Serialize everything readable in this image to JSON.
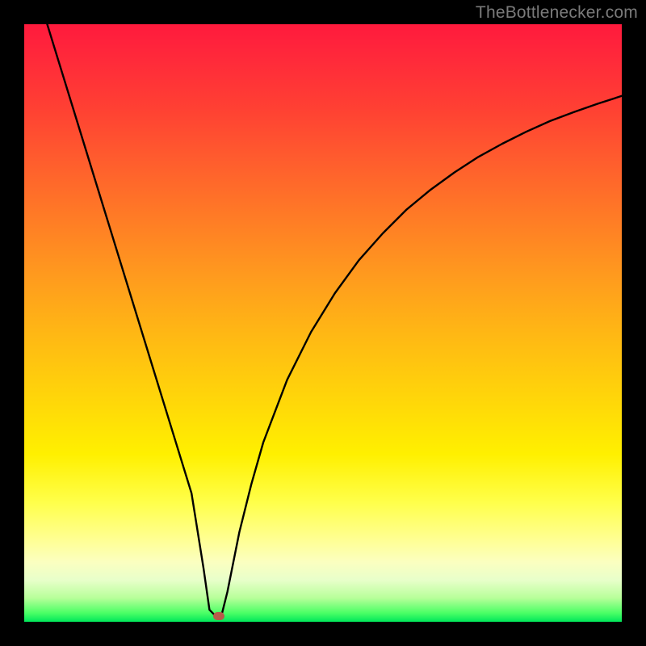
{
  "watermark": {
    "text": "TheBottlenecker.com"
  },
  "chart_data": {
    "type": "line",
    "title": "",
    "xlabel": "",
    "ylabel": "",
    "xlim": [
      0,
      100
    ],
    "ylim": [
      0,
      100
    ],
    "x": [
      0,
      2,
      4,
      6,
      8,
      10,
      12,
      14,
      16,
      18,
      20,
      22,
      24,
      26,
      28,
      30,
      31,
      32,
      33,
      34,
      36,
      38,
      40,
      44,
      48,
      52,
      56,
      60,
      64,
      68,
      72,
      76,
      80,
      84,
      88,
      92,
      96,
      100
    ],
    "y": [
      113,
      106,
      99.5,
      93,
      86.5,
      80,
      73.5,
      67,
      60.5,
      54,
      47.5,
      41,
      34.5,
      28,
      21.5,
      9,
      2,
      1,
      1,
      5,
      15,
      23,
      30,
      40.5,
      48.5,
      55,
      60.5,
      65,
      69,
      72.3,
      75.2,
      77.8,
      80,
      82,
      83.8,
      85.3,
      86.7,
      88
    ],
    "minimum": {
      "x": 32.5,
      "y": 1
    },
    "colors": {
      "line": "#000000",
      "marker": "#b85a4a"
    }
  }
}
